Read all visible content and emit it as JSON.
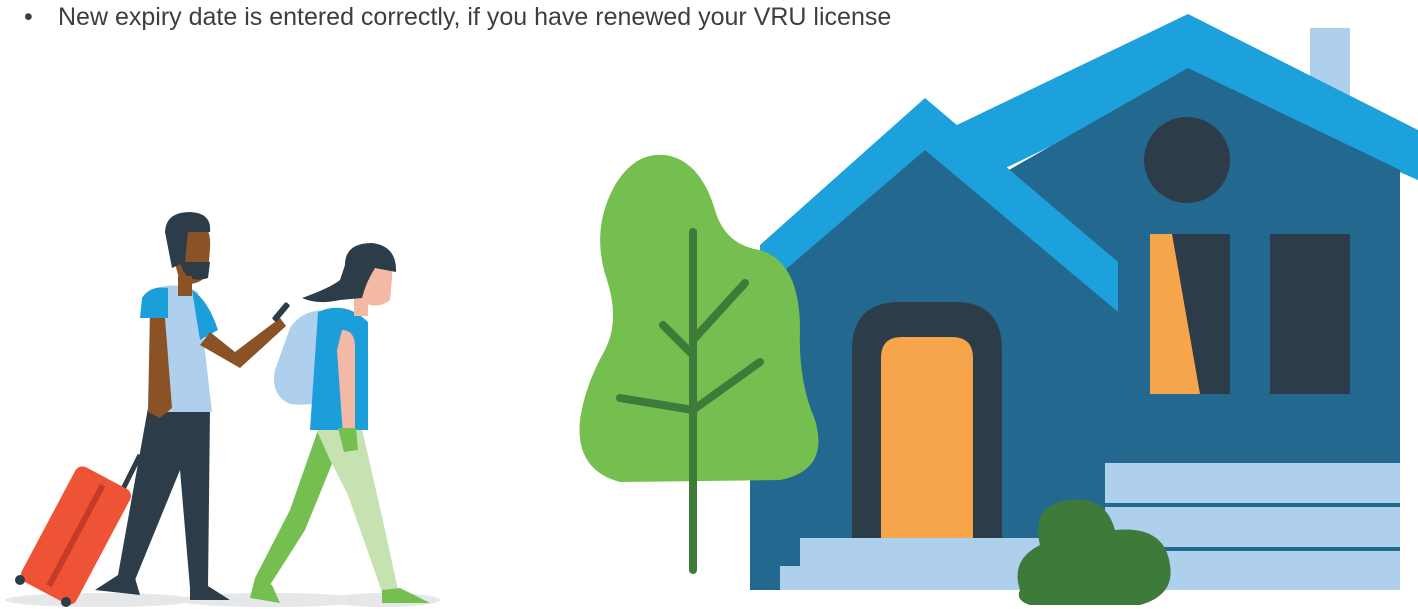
{
  "checklist": {
    "bullet": "•",
    "item_text": "New expiry date is entered correctly, if you have renewed your VRU license"
  },
  "illustration": {
    "icons": [
      "travelers-illustration",
      "tree-illustration",
      "house-illustration",
      "bush-illustration"
    ],
    "colors": {
      "roof_light": "#1da1dc",
      "house_wall": "#23688f",
      "window_dark": "#2c3c48",
      "door_orange": "#f6a54b",
      "steps_light": "#afd0ec",
      "tree_green": "#74bf4f",
      "trunk_dark_green": "#3e7b3a",
      "suitcase_red": "#ef5336",
      "shirt_blue": "#1c9edb",
      "ground_grey": "#e6e7e9"
    }
  }
}
